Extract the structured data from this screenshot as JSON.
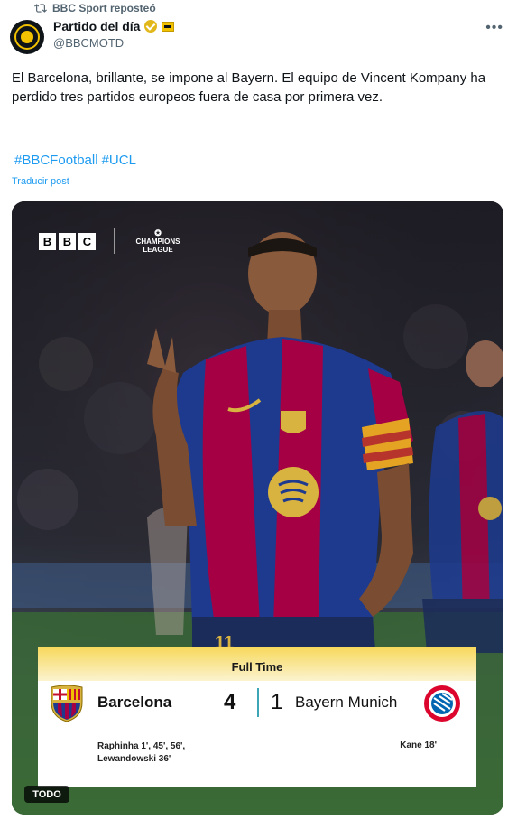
{
  "repost": {
    "label": "BBC Sport reposteó",
    "icon": "repost-icon"
  },
  "author": {
    "display_name": "Partido del día",
    "handle": "@BBCMOTD",
    "verified_icon": "gold-verified-badge-icon",
    "affiliate_icon": "affiliate-badge-icon",
    "avatar_icon": "motd-avatar-icon"
  },
  "more_icon": "more-options-icon",
  "tweet": {
    "text": "El Barcelona, brillante, se impone al Bayern. El equipo de Vincent Kompany ha perdido tres partidos europeos fuera de casa por primera vez.",
    "hashtags": [
      "#BBCFootball",
      "#UCL"
    ],
    "translate_label": "Traducir post"
  },
  "media": {
    "brand": [
      "B",
      "B",
      "C"
    ],
    "competition": [
      "CHAMPIONS",
      "LEAGUE"
    ],
    "player_number": "11",
    "badge": "TODO",
    "scorecard": {
      "status": "Full Time",
      "home_team": "Barcelona",
      "home_score": "4",
      "away_score": "1",
      "away_team": "Bayern Munich",
      "home_scorers": [
        "Raphinha 1', 45', 56',",
        "Lewandowski 36'"
      ],
      "away_scorers": "Kane 18'"
    }
  },
  "colors": {
    "link": "#1d9bf0",
    "barca_blue": "#1d3a8f",
    "barca_red": "#a50044",
    "card_yellow": "#f7d85a"
  }
}
